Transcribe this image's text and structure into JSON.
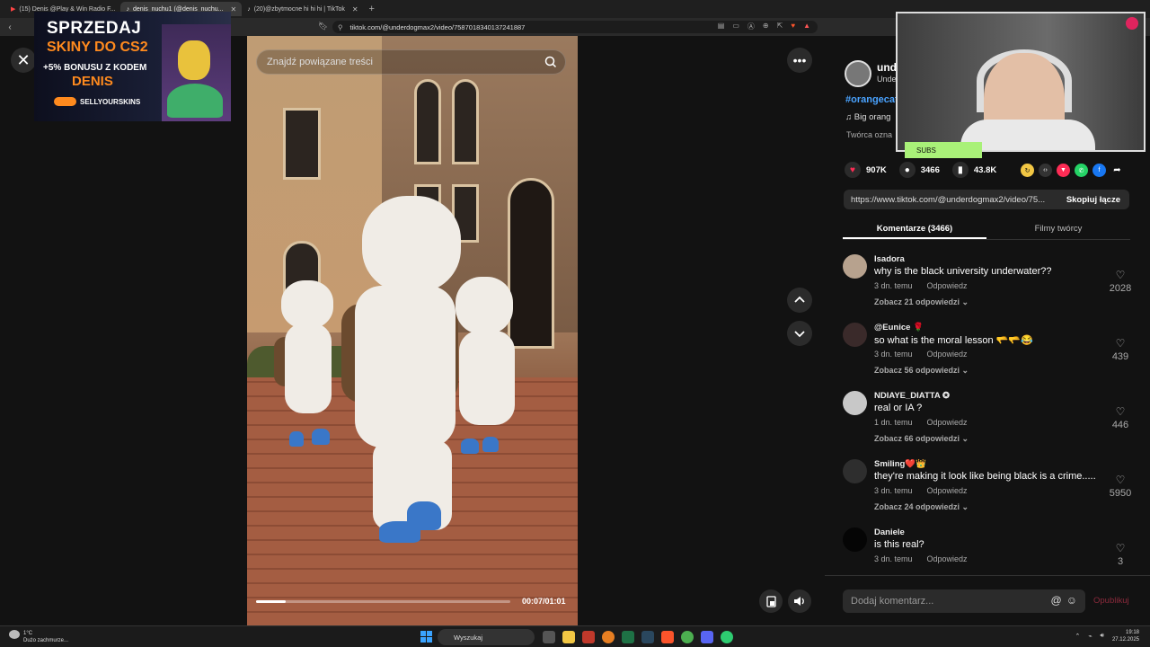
{
  "browser": {
    "tabs": [
      {
        "label": "(15) Denis @Play & Win Radio F..."
      },
      {
        "label": "denis_nuchu1 (@denis_nuchu..."
      },
      {
        "label": "(20)@zbytmocne hi hi hi | TikTok"
      }
    ],
    "url": "tiktok.com/@underdogmax2/video/7587018340137241887"
  },
  "ad": {
    "title": "SPRZEDAJ",
    "subtitle": "SKINY DO CS2",
    "bonus": "+5% BONUSU Z KODEM",
    "code": "DENIS",
    "brand": "SELLYOURSKINS"
  },
  "video": {
    "search_placeholder": "Znajdź powiązane treści",
    "time": "00:07/01:01",
    "progress": 0.115
  },
  "author": {
    "name": "und",
    "nick": "Unde",
    "hashtag": "#orangecat",
    "music": "♫  Big orang",
    "creator_note": "Twórca ozna"
  },
  "webcam": {
    "badge": "SUBS"
  },
  "stats": {
    "likes": "907K",
    "comments": "3466",
    "saves": "43.8K"
  },
  "link": {
    "url": "https://www.tiktok.com/@underdogmax2/video/75...",
    "copy_label": "Skopiuj łącze"
  },
  "tabs": {
    "comments": "Komentarze (3466)",
    "creator_videos": "Filmy twórcy"
  },
  "comments": [
    {
      "user": "Isadora",
      "text": "why is the black university underwater??",
      "time": "3 dn. temu",
      "reply": "Odpowiedz",
      "replies": "Zobacz 21 odpowiedzi ⌄",
      "likes": "2028"
    },
    {
      "user": "@Eunice 🌹",
      "text": "so what is the moral lesson 🫳🫳😂",
      "time": "3 dn. temu",
      "reply": "Odpowiedz",
      "replies": "Zobacz 56 odpowiedzi ⌄",
      "likes": "439"
    },
    {
      "user": "NDIAYE_DIATTA ✪",
      "text": "real or IA ?",
      "time": "1 dn. temu",
      "reply": "Odpowiedz",
      "replies": "Zobacz 66 odpowiedzi ⌄",
      "likes": "446"
    },
    {
      "user": "Smiling❤️👑",
      "text": "they're making it look like being black is a crime.....",
      "time": "3 dn. temu",
      "reply": "Odpowiedz",
      "replies": "Zobacz 24 odpowiedzi ⌄",
      "likes": "5950"
    },
    {
      "user": "Daniele",
      "text": "is this real?",
      "time": "3 dn. temu",
      "reply": "Odpowiedz",
      "replies": "",
      "likes": "3"
    }
  ],
  "comment_input": {
    "placeholder": "Dodaj komentarz...",
    "publish": "Opublikuj"
  },
  "taskbar": {
    "temperature": "1°C",
    "weather": "Dużo zachmurze...",
    "search": "Wyszukaj",
    "time": "19:18",
    "date": "27.12.2025"
  },
  "colors": {
    "accent_red": "#fe2c55",
    "link_blue": "#4aa3ff",
    "ad_orange": "#ff8a1e",
    "subs_green": "#a9f178"
  }
}
